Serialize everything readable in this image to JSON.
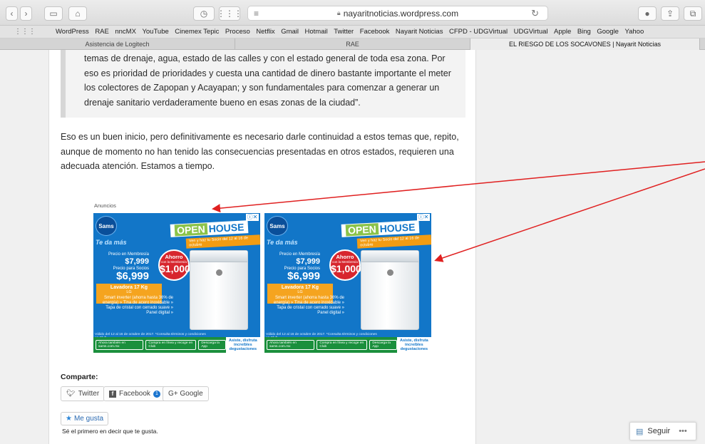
{
  "toolbar": {
    "back_icon": "chevron-left",
    "forward_icon": "chevron-right",
    "sidebar_icon": "sidebar",
    "home_icon": "home",
    "history_icon": "clock",
    "grid_icon": "grid",
    "reader_icon": "lines",
    "url": "nayaritnoticias.wordpress.com",
    "share_icon": "share",
    "tabs_icon": "tabs"
  },
  "bookmarks": [
    "WordPress",
    "RAE",
    "nncMX",
    "YouTube",
    "Cinemex Tepic",
    "Proceso",
    "Netflix",
    "Gmail",
    "Hotmail",
    "Twitter",
    "Facebook",
    "Nayarit Noticias",
    "CFPD - UDGVirtual",
    "UDGVirtual",
    "Apple",
    "Bing",
    "Google",
    "Yahoo"
  ],
  "tabs": [
    "Asistencia de Logitech",
    "RAE",
    "EL RIESGO DE LOS SOCAVONES | Nayarit Noticias"
  ],
  "article": {
    "quote": "temas de drenaje, agua, estado de las calles y con el estado general de toda esa zona. Por eso es prioridad de prioridades y cuesta una cantidad de dinero bastante importante el meter los colectores de Zapopan y Acayapan; y son fundamentales para comenzar a generar un drenaje sanitario verdaderamente bueno en esas zonas de la ciudad”.",
    "paragraph": "Eso es un buen inicio, pero definitivamente es necesario darle continuidad a estos temas que, repito, aunque de momento no han tenido las consecuencias presentadas en otros estados, requieren una adecuada atención. Estamos a tiempo."
  },
  "ads": {
    "label": "Anuncios",
    "brand": "Sams",
    "headline_a": "OPEN",
    "headline_b": "HOUSE",
    "dates": "Ven y haz tu Socio del 12 al 16 de octubre",
    "tagline": "Te da más",
    "member_price_label": "Precio en Membresía",
    "member_price": "$7,999",
    "partner_price_label": "Precio para Socios",
    "partner_price": "$6,999",
    "savings_label": "Ahorro",
    "savings_sub": "con la Membresía",
    "savings": "$1,000",
    "product": "Lavadora 17 Kg",
    "product_brand": "LG",
    "features": "Smart inverter (ahorra hasta 36% de energía) » Tina de acero inoxidable » Tapa de cristal con cerrado suave » Panel digital »",
    "legal": "Válido del 12 al 16 de octubre de 2017. *Consulta términos y condiciones en Club",
    "footer_a": "Ahora también en sams.com.mx",
    "footer_b": "Compra en línea y recoge en Club",
    "footer_c": "Descarga la App",
    "footer_d": "Asiste, disfruta increíbles degustaciones"
  },
  "share": {
    "title": "Comparte:",
    "twitter": "Twitter",
    "facebook": "Facebook",
    "facebook_count": "1",
    "google": "G+ Google",
    "like": "Me gusta",
    "first_like": "Sé el primero en decir que te gusta."
  },
  "follow": {
    "label": "Seguir",
    "more": "•••"
  },
  "colors": {
    "ad_blue": "#1276c8",
    "annotation_red": "#e02020"
  }
}
